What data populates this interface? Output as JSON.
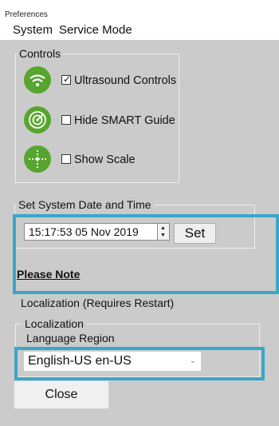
{
  "window": {
    "title": "Preferences"
  },
  "menu": {
    "items": [
      "System",
      "Service Mode"
    ]
  },
  "controls": {
    "group_label": "Controls",
    "items": [
      {
        "label": "Ultrasound Controls",
        "checked": true,
        "icon": "ultrasound-waves-icon"
      },
      {
        "label": "Hide SMART Guide",
        "checked": false,
        "icon": "radar-target-icon"
      },
      {
        "label": "Show Scale",
        "checked": false,
        "icon": "crosshair-scale-icon"
      }
    ],
    "check_mark": "✓"
  },
  "datetime": {
    "group_label": "Set System Date and Time",
    "value": "15:17:53  05 Nov 2019",
    "set_label": "Set"
  },
  "note": {
    "label": "Please Note"
  },
  "localization": {
    "heading": "Localization (Requires Restart)",
    "group_label": "Localization",
    "region_label": "Language Region",
    "selected": "English-US en-US"
  },
  "footer": {
    "close_label": "Close"
  },
  "colors": {
    "highlight": "#3aa7c6",
    "icon_green": "#57a52f",
    "background": "#cbcbcb"
  }
}
